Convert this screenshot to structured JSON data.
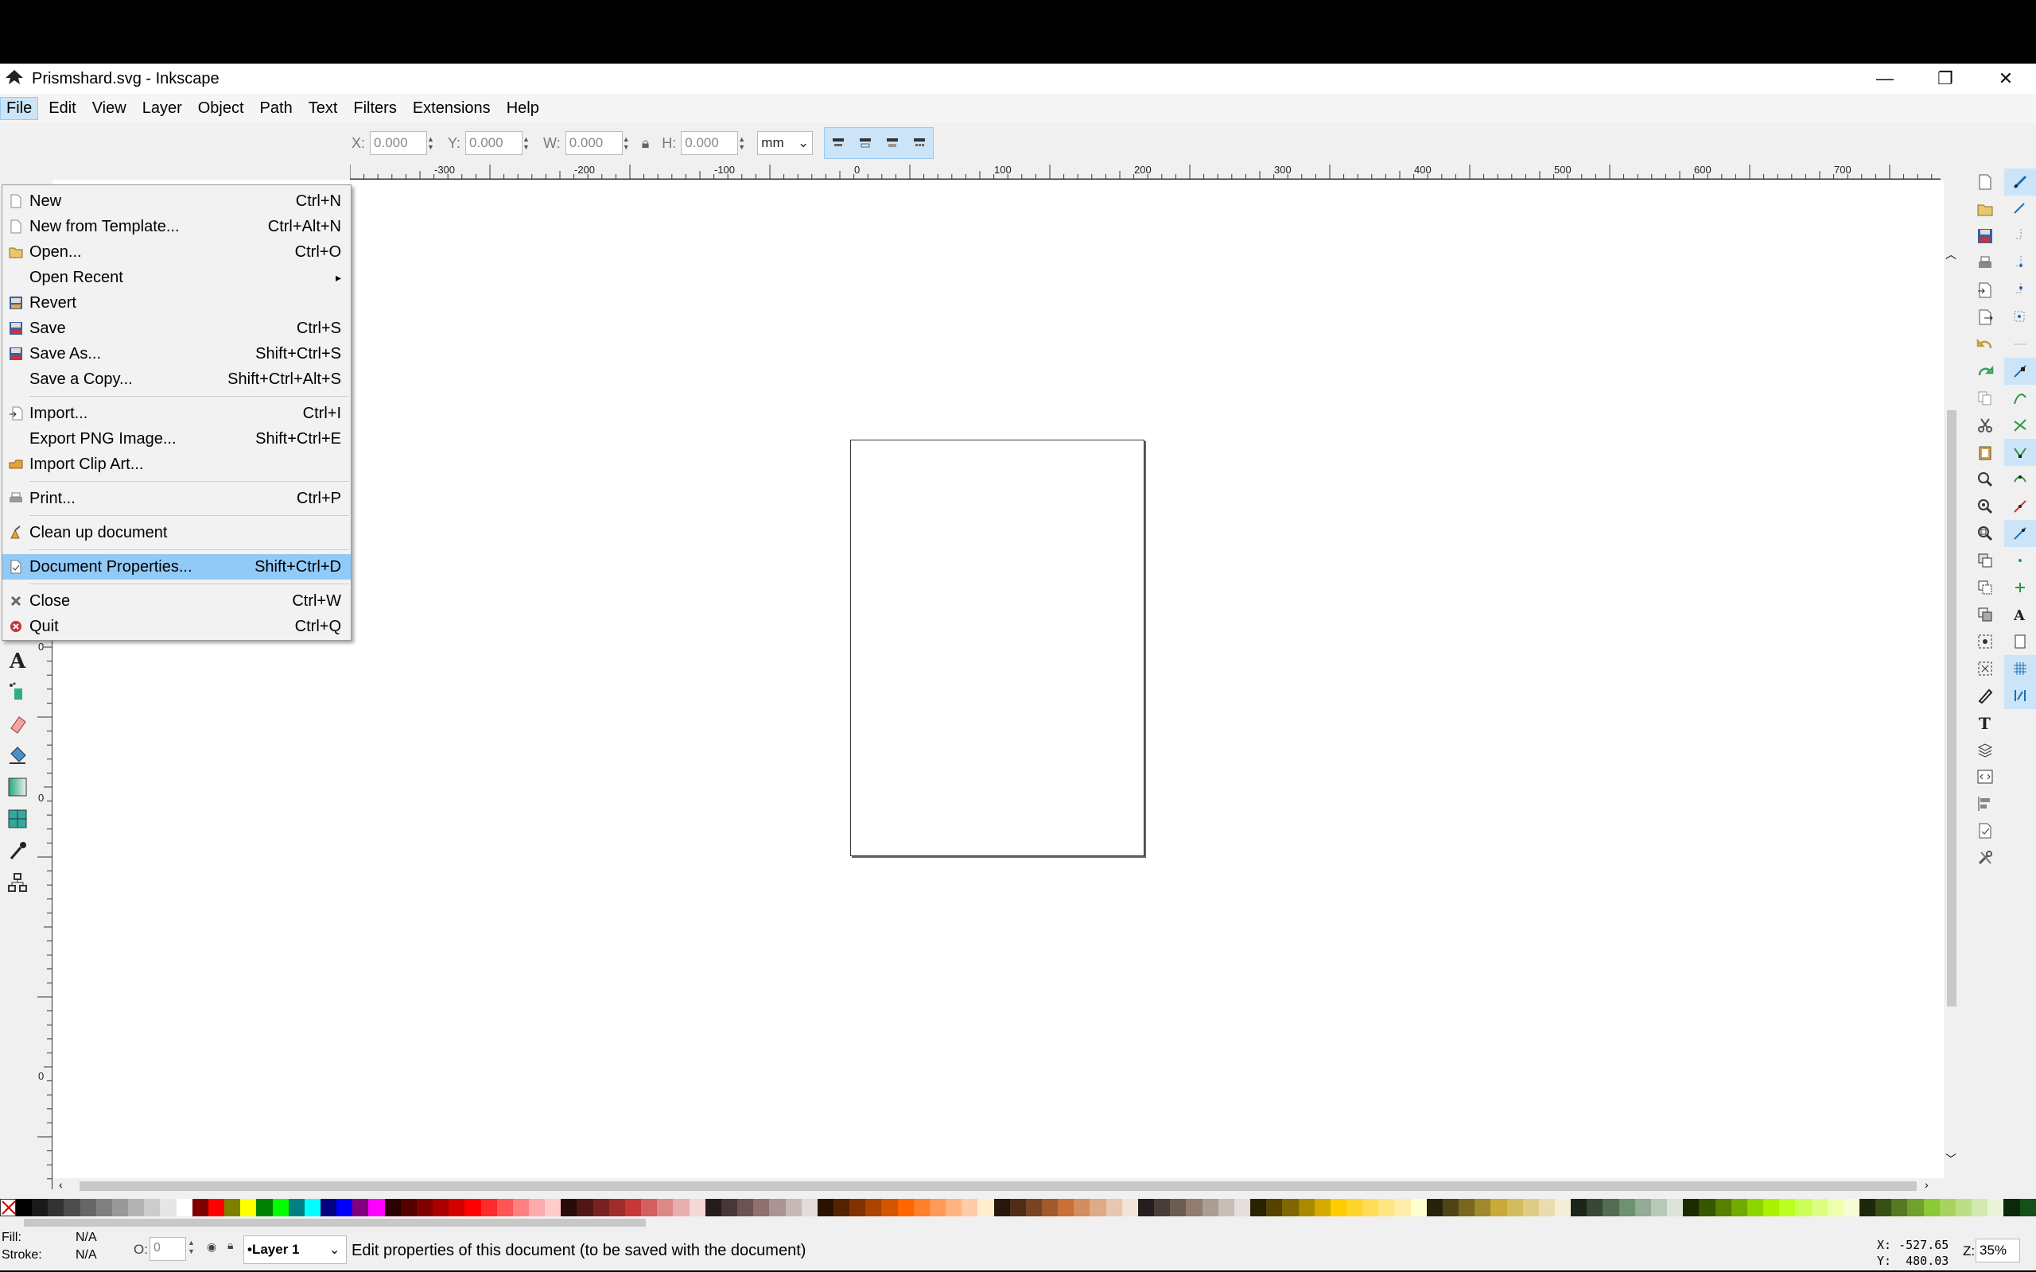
{
  "window": {
    "title": "Prismshard.svg - Inkscape"
  },
  "menubar": [
    "File",
    "Edit",
    "View",
    "Layer",
    "Object",
    "Path",
    "Text",
    "Filters",
    "Extensions",
    "Help"
  ],
  "file_menu": {
    "items": [
      {
        "label": "New",
        "shortcut": "Ctrl+N",
        "icon": "new-document-icon"
      },
      {
        "label": "New from Template...",
        "shortcut": "Ctrl+Alt+N",
        "icon": "template-icon"
      },
      {
        "label": "Open...",
        "shortcut": "Ctrl+O",
        "icon": "open-icon"
      },
      {
        "label": "Open Recent",
        "shortcut": "",
        "icon": "",
        "submenu_arrow": "▸"
      },
      {
        "label": "Revert",
        "shortcut": "",
        "icon": "revert-icon"
      },
      {
        "label": "Save",
        "shortcut": "Ctrl+S",
        "icon": "save-icon"
      },
      {
        "label": "Save As...",
        "shortcut": "Shift+Ctrl+S",
        "icon": "save-as-icon"
      },
      {
        "label": "Save a Copy...",
        "shortcut": "Shift+Ctrl+Alt+S",
        "icon": ""
      },
      {
        "label": "Import...",
        "shortcut": "Ctrl+I",
        "icon": "import-icon"
      },
      {
        "label": "Export PNG Image...",
        "shortcut": "Shift+Ctrl+E",
        "icon": "export-icon"
      },
      {
        "label": "Import Clip Art...",
        "shortcut": "",
        "icon": "clipart-icon"
      },
      {
        "label": "Print...",
        "shortcut": "Ctrl+P",
        "icon": "print-icon"
      },
      {
        "label": "Clean up document",
        "shortcut": "",
        "icon": "cleanup-icon"
      },
      {
        "label": "Document Properties...",
        "shortcut": "Shift+Ctrl+D",
        "icon": "document-properties-icon"
      },
      {
        "label": "Close",
        "shortcut": "Ctrl+W",
        "icon": "close-icon"
      },
      {
        "label": "Quit",
        "shortcut": "Ctrl+Q",
        "icon": "quit-icon"
      }
    ],
    "selected": "Document Properties..."
  },
  "toolbar": {
    "x_label": "X:",
    "x_value": "0.000",
    "y_label": "Y:",
    "y_value": "0.000",
    "w_label": "W:",
    "w_value": "0.000",
    "h_label": "H:",
    "h_value": "0.000",
    "unit": "mm"
  },
  "ruler": {
    "h_labels": [
      "-300",
      "-200",
      "-100",
      "0",
      "100",
      "200",
      "300",
      "400",
      "500",
      "600",
      "700"
    ],
    "v_labels": [
      "0",
      "0",
      "0"
    ]
  },
  "status": {
    "fill_label": "Fill:",
    "fill_value": "N/A",
    "stroke_label": "Stroke:",
    "stroke_value": "N/A",
    "opacity_label": "O:",
    "opacity_value": "0",
    "layer": "•Layer 1",
    "message": "Edit properties of this document (to be saved with the document)",
    "cursor_x": "X: -527.65",
    "cursor_y": "Y:  480.03",
    "zoom_label": "Z:",
    "zoom_value": "35%"
  },
  "colors": {
    "menu_highlight": "#91c9f7",
    "toggle_on": "#cce4f7"
  }
}
